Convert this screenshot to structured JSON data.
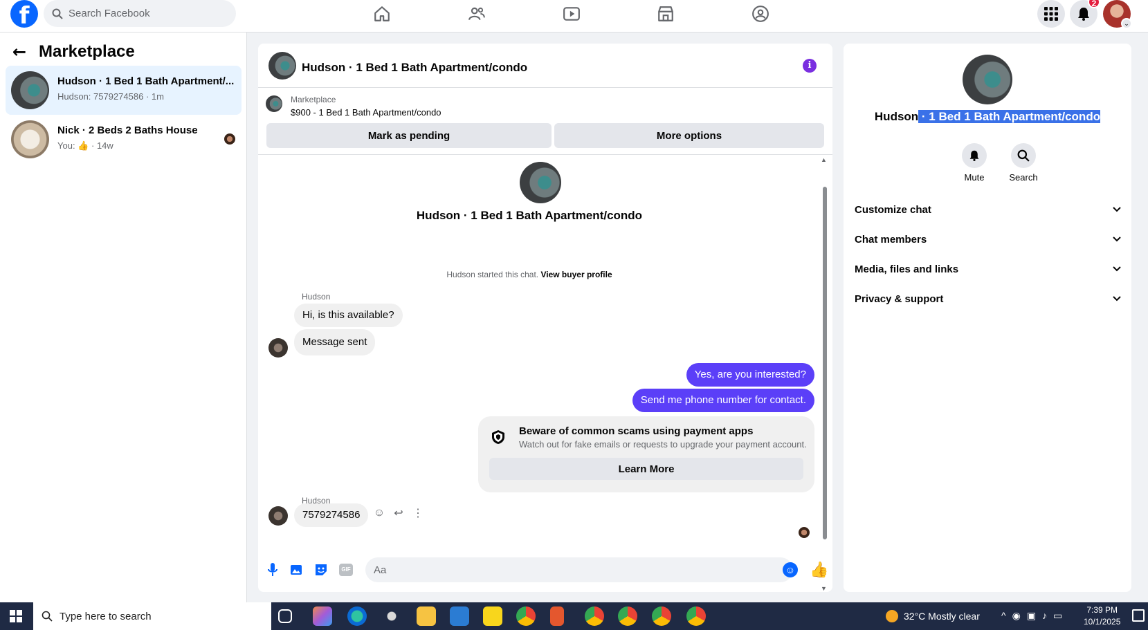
{
  "topbar": {
    "logo": "f",
    "search_placeholder": "Search Facebook",
    "nav_icons": [
      "home-icon",
      "friends-icon",
      "video-icon",
      "marketplace-icon",
      "groups-icon"
    ],
    "notification_count": "2",
    "caret": "⌄"
  },
  "sidebar": {
    "back": "←",
    "title": "Marketplace",
    "conversations": [
      {
        "title": "Hudson · 1 Bed 1 Bath Apartment/...",
        "subtitle": "Hudson: 7579274586 · 1m",
        "active": true
      },
      {
        "title": "Nick · 2 Beds 2 Baths House",
        "subtitle_prefix": "You:",
        "subtitle_suffix": "· 14w",
        "active": false
      }
    ]
  },
  "chat": {
    "header_title": "Hudson · 1 Bed 1 Bath Apartment/condo",
    "info": "i",
    "listing_label": "Marketplace",
    "listing_price": "$900 - 1 Bed 1 Bath Apartment/condo",
    "pending_button": "Mark as pending",
    "options_button": "More options",
    "conversation_title": "Hudson · 1 Bed 1 Bath Apartment/condo",
    "started_text": "Hudson started this chat.",
    "view_profile": "View buyer profile",
    "sender": "Hudson",
    "messages_in_1": "Hi, is this available?",
    "messages_in_2": "Message sent",
    "messages_out_1": "Yes, are you interested?",
    "messages_out_2": "Send me phone number for contact.",
    "scam_title": "Beware of common scams using payment apps",
    "scam_desc": "Watch out for fake emails or requests to upgrade your payment account.",
    "learn_more": "Learn More",
    "last_message": "7579274586",
    "composer_placeholder": "Aa",
    "gif_label": "GIF"
  },
  "info_panel": {
    "title_name": "Hudson",
    "title_rest": " · 1 Bed 1 Bath Apartment/condo",
    "mute": "Mute",
    "search": "Search",
    "sections": [
      "Customize chat",
      "Chat members",
      "Media, files and links",
      "Privacy & support"
    ]
  },
  "taskbar": {
    "search_placeholder": "Type here to search",
    "weather": "32°C  Mostly clear",
    "time": "7:39 PM",
    "date": "10/1/2025",
    "tray_icons": [
      "chevron-up-icon",
      "location-icon",
      "meet-icon",
      "speaker-icon",
      "network-icon"
    ]
  },
  "colors": {
    "brand": "#0866ff",
    "outgoing_bubble": "#5b3ff8",
    "selection_highlight": "#3a71e8"
  }
}
